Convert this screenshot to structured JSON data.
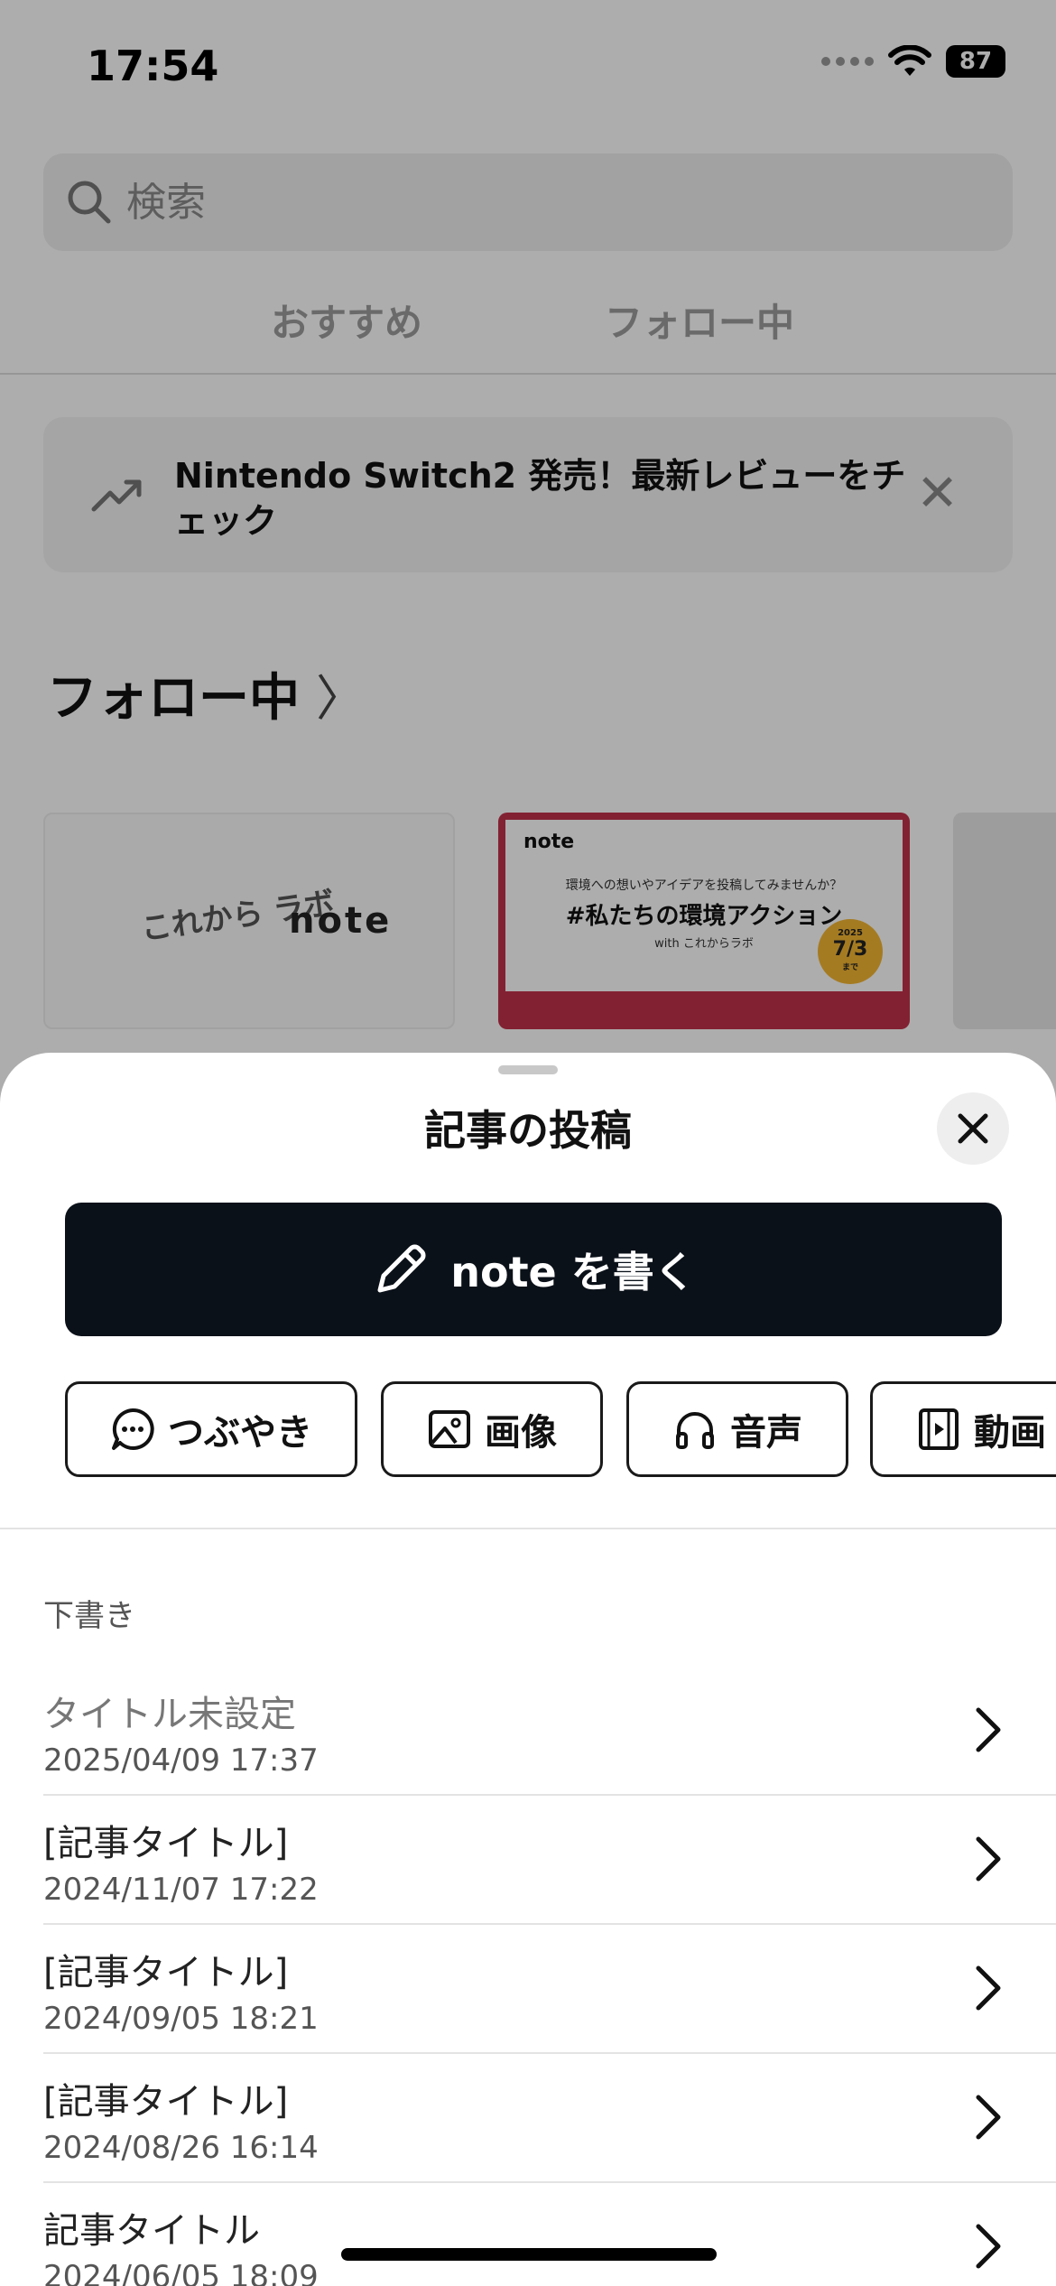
{
  "status_bar": {
    "time": "17:54",
    "battery": "87"
  },
  "search": {
    "placeholder": "検索"
  },
  "tabs": [
    {
      "label": "おすすめ"
    },
    {
      "label": "フォロー中"
    }
  ],
  "banner": {
    "text": "Nintendo Switch2 発売！最新レビューをチェック"
  },
  "following": {
    "title": "フォロー中",
    "cards": [
      {
        "logo_left": "これから ラボ",
        "logo_right": "note"
      },
      {
        "brand": "note",
        "subtitle": "環境への想いやアイデアを投稿してみませんか？",
        "headline": "#私たちの環境アクション",
        "with_text": "with これからラボ",
        "badge_year": "2025",
        "badge_date": "7/3",
        "badge_until": "まで"
      }
    ]
  },
  "sheet": {
    "title": "記事の投稿",
    "write_button": "note を書く",
    "types": [
      {
        "label": "つぶやき",
        "icon": "chat-bubble-icon"
      },
      {
        "label": "画像",
        "icon": "image-icon"
      },
      {
        "label": "音声",
        "icon": "headphones-icon"
      },
      {
        "label": "動画",
        "icon": "film-icon"
      }
    ],
    "drafts_label": "下書き",
    "drafts": [
      {
        "title": "タイトル未設定",
        "date": "2025/04/09 17:37"
      },
      {
        "title": "[記事タイトル]",
        "date": "2024/11/07 17:22"
      },
      {
        "title": "[記事タイトル]",
        "date": "2024/09/05 18:21"
      },
      {
        "title": "[記事タイトル]",
        "date": "2024/08/26 16:14"
      },
      {
        "title": "記事タイトル",
        "date": "2024/06/05 18:09"
      }
    ]
  },
  "colors": {
    "write_button_bg": "#0b1119",
    "card_accent": "#c0324a",
    "badge": "#f3b533"
  }
}
